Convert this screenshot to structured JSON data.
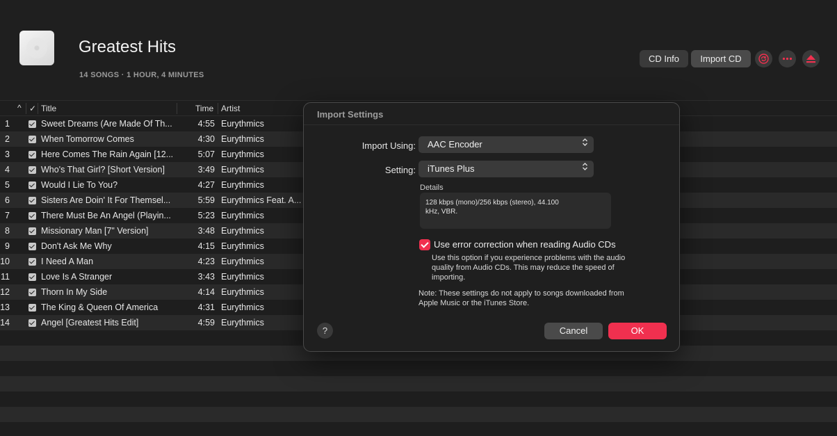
{
  "album": {
    "title": "Greatest Hits",
    "meta": "14 SONGS · 1 HOUR, 4 MINUTES"
  },
  "header_buttons": {
    "cd_info": "CD Info",
    "import_cd": "Import CD"
  },
  "table": {
    "headers": {
      "sort": "^",
      "check": "✓",
      "title": "Title",
      "time": "Time",
      "artist": "Artist"
    },
    "rows": [
      {
        "num": "1",
        "title": "Sweet Dreams (Are Made Of Th...",
        "time": "4:55",
        "artist": "Eurythmics"
      },
      {
        "num": "2",
        "title": "When Tomorrow Comes",
        "time": "4:30",
        "artist": "Eurythmics"
      },
      {
        "num": "3",
        "title": "Here Comes The Rain Again [12...",
        "time": "5:07",
        "artist": "Eurythmics"
      },
      {
        "num": "4",
        "title": "Who's That Girl? [Short Version]",
        "time": "3:49",
        "artist": "Eurythmics"
      },
      {
        "num": "5",
        "title": "Would I Lie To You?",
        "time": "4:27",
        "artist": "Eurythmics"
      },
      {
        "num": "6",
        "title": "Sisters Are Doin' It For Themsel...",
        "time": "5:59",
        "artist": "Eurythmics Feat. A..."
      },
      {
        "num": "7",
        "title": "There Must Be An Angel (Playin...",
        "time": "5:23",
        "artist": "Eurythmics"
      },
      {
        "num": "8",
        "title": "Missionary Man [7\" Version]",
        "time": "3:48",
        "artist": "Eurythmics"
      },
      {
        "num": "9",
        "title": "Don't Ask Me Why",
        "time": "4:15",
        "artist": "Eurythmics"
      },
      {
        "num": "10",
        "title": "I Need A Man",
        "time": "4:23",
        "artist": "Eurythmics"
      },
      {
        "num": "11",
        "title": "Love Is A Stranger",
        "time": "3:43",
        "artist": "Eurythmics"
      },
      {
        "num": "12",
        "title": "Thorn In My Side",
        "time": "4:14",
        "artist": "Eurythmics"
      },
      {
        "num": "13",
        "title": "The King & Queen Of America",
        "time": "4:31",
        "artist": "Eurythmics"
      },
      {
        "num": "14",
        "title": "Angel [Greatest Hits Edit]",
        "time": "4:59",
        "artist": "Eurythmics"
      }
    ]
  },
  "dialog": {
    "title": "Import Settings",
    "import_using_label": "Import Using:",
    "import_using_value": "AAC Encoder",
    "setting_label": "Setting:",
    "setting_value": "iTunes Plus",
    "details_label": "Details",
    "details_line1": "128 kbps (mono)/256 kbps (stereo), 44.100",
    "details_line2": "kHz, VBR.",
    "error_correction_label": "Use error correction when reading Audio CDs",
    "error_correction_checked": true,
    "error_correction_help": "Use this option if you experience problems with the audio quality from Audio CDs. This may reduce the speed of importing.",
    "note": "Note: These settings do not apply to songs downloaded from Apple Music or the iTunes Store.",
    "help": "?",
    "cancel": "Cancel",
    "ok": "OK"
  },
  "colors": {
    "accent": "#f0304f",
    "background": "#1e1e1e",
    "row_alt": "#2a2a2a"
  },
  "icons": {
    "sync": "sync-icon",
    "more": "ellipsis-icon",
    "eject": "eject-icon",
    "album_art": "cd-icon",
    "select_chevrons": "up-down-chevron-icon"
  }
}
